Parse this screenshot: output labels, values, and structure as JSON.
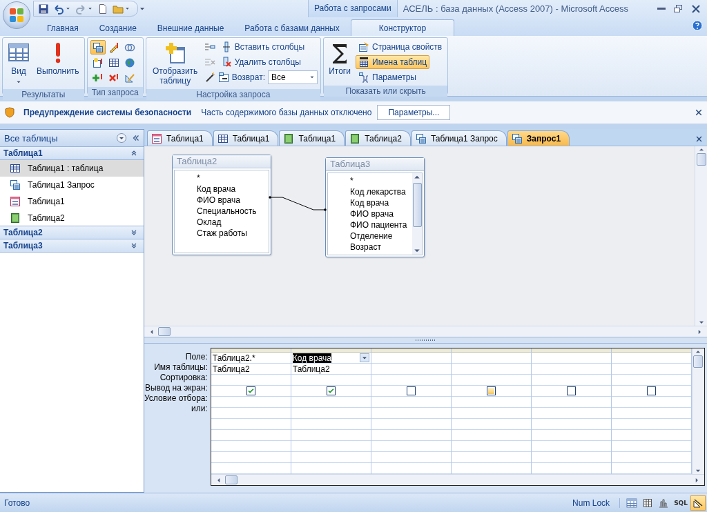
{
  "window": {
    "context_tab": "Работа с запросами",
    "title": "АСЕЛЬ : база данных (Access 2007) - Microsoft Access"
  },
  "ribbon_tabs": [
    {
      "label": "Главная",
      "selected": false
    },
    {
      "label": "Создание",
      "selected": false
    },
    {
      "label": "Внешние данные",
      "selected": false
    },
    {
      "label": "Работа с базами данных",
      "selected": false
    },
    {
      "label": "Конструктор",
      "selected": true
    }
  ],
  "ribbon_groups": [
    {
      "title": "Результаты",
      "items": [
        {
          "kind": "large",
          "label": "Вид",
          "dropdown": true
        },
        {
          "kind": "large",
          "label": "Выполнить"
        }
      ]
    },
    {
      "title": "Тип запроса",
      "items": [
        {
          "kind": "icon",
          "selected": true
        },
        {
          "kind": "icon",
          "selected": false
        },
        {
          "kind": "icon",
          "selected": false
        },
        {
          "kind": "icon",
          "selected": false
        },
        {
          "kind": "icon",
          "selected": false
        },
        {
          "kind": "icon",
          "selected": false
        },
        {
          "kind": "icon",
          "selected": false
        },
        {
          "kind": "icon",
          "selected": false
        },
        {
          "kind": "icon",
          "selected": false
        }
      ]
    },
    {
      "title": "Настройка запроса",
      "items": [
        {
          "kind": "large",
          "label": "Отобразить таблицу"
        },
        {
          "kind": "small",
          "label": "Вставить столбцы",
          "selected": false
        },
        {
          "kind": "small",
          "label": "Удалить столбцы",
          "selected": false
        },
        {
          "kind": "combo",
          "label": "Возврат:",
          "value": "Все"
        }
      ]
    },
    {
      "title": "Показать или скрыть",
      "items": [
        {
          "kind": "large",
          "label": "Итоги"
        },
        {
          "kind": "small",
          "label": "Страница свойств",
          "selected": false
        },
        {
          "kind": "small",
          "label": "Имена таблиц",
          "selected": true
        },
        {
          "kind": "small",
          "label": "Параметры",
          "selected": false
        }
      ]
    }
  ],
  "security_bar": {
    "title": "Предупреждение системы безопасности",
    "message": "Часть содержимого базы данных отключено",
    "button": "Параметры..."
  },
  "nav": {
    "title": "Все таблицы",
    "groups": [
      {
        "title": "Таблица1",
        "expanded": true,
        "items": [
          {
            "kind": "table",
            "label": "Таблица1 : таблица",
            "selected": true
          },
          {
            "kind": "query",
            "label": "Таблица1 Запрос",
            "selected": false
          },
          {
            "kind": "form",
            "label": "Таблица1",
            "selected": false
          },
          {
            "kind": "report",
            "label": "Таблица2",
            "selected": false
          }
        ]
      },
      {
        "title": "Таблица2",
        "expanded": false
      },
      {
        "title": "Таблица3",
        "expanded": false
      }
    ]
  },
  "doc_tabs": [
    {
      "kind": "form",
      "label": "Таблица1",
      "selected": false
    },
    {
      "kind": "table",
      "label": "Таблица1",
      "selected": false
    },
    {
      "kind": "report",
      "label": "Таблица1",
      "selected": false
    },
    {
      "kind": "report",
      "label": "Таблица2",
      "selected": false
    },
    {
      "kind": "query",
      "label": "Таблица1 Запрос",
      "selected": false
    },
    {
      "kind": "query",
      "label": "Запрос1",
      "selected": true
    }
  ],
  "field_lists": [
    {
      "title": "Таблица2",
      "scrollbar": false,
      "fields": [
        "*",
        "Код врача",
        "ФИО врача",
        "Специальность",
        "Оклад",
        "Стаж работы"
      ]
    },
    {
      "title": "Таблица3",
      "scrollbar": true,
      "fields": [
        "*",
        "Код лекарства",
        "Код врача",
        "ФИО врача",
        "ФИО пациента",
        "Отделение",
        "Возраст"
      ]
    }
  ],
  "grid": {
    "row_labels": [
      "Поле:",
      "Имя таблицы:",
      "Сортировка:",
      "Вывод на экран:",
      "Условие отбора:",
      "или:"
    ],
    "columns": [
      {
        "field": "Таблица2.*",
        "table": "Таблица2",
        "show": true,
        "active": false,
        "hover": false
      },
      {
        "field": "Код врача",
        "table": "Таблица2",
        "show": true,
        "active": true,
        "hover": false
      },
      {
        "show": false,
        "active": false,
        "hover": false
      },
      {
        "show": false,
        "active": false,
        "hover": true
      },
      {
        "show": false,
        "active": false,
        "hover": false
      },
      {
        "show": false,
        "active": false,
        "hover": false
      }
    ]
  },
  "status_bar": {
    "text": "Готово",
    "indicator": "Num Lock",
    "views": [
      {
        "kind": "datasheet",
        "selected": false
      },
      {
        "kind": "pivot_table",
        "selected": false
      },
      {
        "kind": "pivot_chart",
        "selected": false
      },
      {
        "kind": "sql",
        "label": "SQL",
        "selected": false
      },
      {
        "kind": "design",
        "selected": true
      }
    ]
  }
}
